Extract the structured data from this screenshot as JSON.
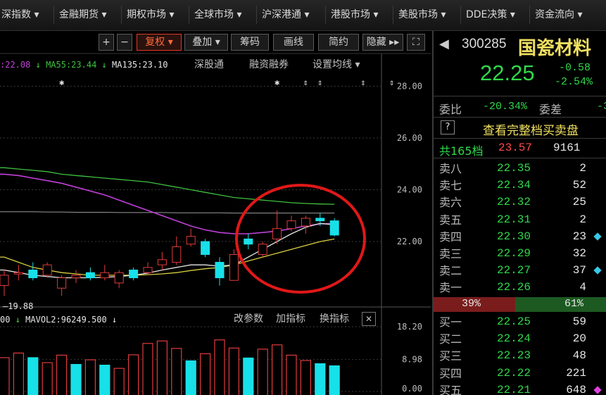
{
  "menu": [
    {
      "label": "深指数",
      "arrow": "▾"
    },
    {
      "label": "金融期货",
      "arrow": "▾"
    },
    {
      "label": "期权市场",
      "arrow": "▾"
    },
    {
      "label": "全球市场",
      "arrow": "▾"
    },
    {
      "label": "沪深港通",
      "arrow": "▾"
    },
    {
      "label": "港股市场",
      "arrow": "▾"
    },
    {
      "label": "美股市场",
      "arrow": "▾"
    },
    {
      "label": "DDE决策",
      "arrow": "▾"
    },
    {
      "label": "资金流向",
      "arrow": "▾"
    }
  ],
  "toolbar": {
    "plus": "+",
    "minus": "−",
    "fuquan": "复权 ▾",
    "diejia": "叠加 ▾",
    "chouma": "筹码",
    "huaxian": "画线",
    "jianyue": "简约",
    "yincang": "隐藏 ▸▸",
    "fullscreen": "⛶"
  },
  "ma": {
    "ma_partial": ":22.08",
    "ma_partial_arrow": "↓",
    "ma55": "MA55:23.44",
    "ma55_arrow": "↓",
    "ma135": "MA135:23.10",
    "option1": "深股通",
    "option2": "融资融券",
    "option3": "设置均线 ▾"
  },
  "price_axis": [
    "28.00",
    "26.00",
    "24.00",
    "22.00"
  ],
  "low_label": "19.88",
  "volume": {
    "line1": "00",
    "arrow1": "↓",
    "mavol2": "MAVOL2:96249.500",
    "arrow2": "↓",
    "opt1": "改参数",
    "opt2": "加指标",
    "opt3": "换指标",
    "close": "✕",
    "axis": [
      "18.20",
      "8.98",
      "0.00"
    ]
  },
  "quote": {
    "code": "300285",
    "name": "国瓷材料",
    "price": "22.25",
    "change": "-0.58",
    "change_pct": "-2.54%",
    "weibi_label": "委比",
    "weibi_value": "-20.34%",
    "weicha_label": "委差",
    "weicha_value": "-3",
    "help": "?",
    "full_book_link": "查看完整档买卖盘",
    "levels_label": "共165档",
    "levels_price": "23.57",
    "levels_vol": "9161",
    "sell": [
      {
        "label": "卖八",
        "price": "22.35",
        "vol": "2",
        "mark": ""
      },
      {
        "label": "卖七",
        "price": "22.34",
        "vol": "52",
        "mark": ""
      },
      {
        "label": "卖六",
        "price": "22.32",
        "vol": "25",
        "mark": ""
      },
      {
        "label": "卖五",
        "price": "22.31",
        "vol": "2",
        "mark": ""
      },
      {
        "label": "卖四",
        "price": "22.30",
        "vol": "23",
        "mark": "#38c8e8"
      },
      {
        "label": "卖三",
        "price": "22.29",
        "vol": "32",
        "mark": ""
      },
      {
        "label": "卖二",
        "price": "22.27",
        "vol": "37",
        "mark": "#38c8e8"
      },
      {
        "label": "卖一",
        "price": "22.26",
        "vol": "4",
        "mark": ""
      }
    ],
    "ratio_sell": "39%",
    "ratio_buy": "61%",
    "buy": [
      {
        "label": "买一",
        "price": "22.25",
        "vol": "59",
        "mark": ""
      },
      {
        "label": "买二",
        "price": "22.24",
        "vol": "20",
        "mark": ""
      },
      {
        "label": "买三",
        "price": "22.23",
        "vol": "48",
        "mark": ""
      },
      {
        "label": "买四",
        "price": "22.22",
        "vol": "221",
        "mark": ""
      },
      {
        "label": "买五",
        "price": "22.21",
        "vol": "648",
        "mark": "#e040e0"
      }
    ]
  },
  "colors": {
    "up": "#e03b3b",
    "down": "#18e0e8",
    "ma_white": "#e6e6e6",
    "ma_yellow": "#d8d040",
    "ma_magenta": "#c040d8",
    "ma_green": "#40c040",
    "circle": "#e01818",
    "price_green": "#30d84a"
  },
  "chart_data": [
    {
      "type": "candlestick",
      "ylim": [
        19.5,
        28.5
      ],
      "y_ticks": [
        28.0,
        26.0,
        24.0,
        22.0
      ],
      "low_annotation": 19.88,
      "candles": [
        {
          "o": 20.3,
          "c": 20.7,
          "h": 20.9,
          "l": 19.9
        },
        {
          "o": 20.8,
          "c": 20.8,
          "h": 21.1,
          "l": 20.5
        },
        {
          "o": 20.9,
          "c": 20.6,
          "h": 21.2,
          "l": 20.5
        },
        {
          "o": 20.7,
          "c": 21.1,
          "h": 21.2,
          "l": 20.6
        },
        {
          "o": 20.2,
          "c": 20.6,
          "h": 20.7,
          "l": 19.9
        },
        {
          "o": 20.6,
          "c": 20.7,
          "h": 20.9,
          "l": 20.4
        },
        {
          "o": 20.8,
          "c": 20.6,
          "h": 21.0,
          "l": 20.5
        },
        {
          "o": 20.6,
          "c": 20.8,
          "h": 21.1,
          "l": 20.5
        },
        {
          "o": 20.4,
          "c": 20.8,
          "h": 20.9,
          "l": 20.2
        },
        {
          "o": 20.9,
          "c": 20.6,
          "h": 21.0,
          "l": 20.5
        },
        {
          "o": 20.8,
          "c": 21.0,
          "h": 21.2,
          "l": 20.7
        },
        {
          "o": 21.1,
          "c": 21.3,
          "h": 21.6,
          "l": 20.9
        },
        {
          "o": 21.2,
          "c": 21.8,
          "h": 22.2,
          "l": 21.1
        },
        {
          "o": 21.9,
          "c": 22.2,
          "h": 22.5,
          "l": 21.8
        },
        {
          "o": 22.0,
          "c": 21.5,
          "h": 22.1,
          "l": 21.4
        },
        {
          "o": 21.2,
          "c": 20.6,
          "h": 21.4,
          "l": 20.3
        },
        {
          "o": 20.5,
          "c": 21.5,
          "h": 21.7,
          "l": 20.5
        },
        {
          "o": 22.1,
          "c": 21.9,
          "h": 22.3,
          "l": 21.7
        },
        {
          "o": 21.5,
          "c": 21.9,
          "h": 22.0,
          "l": 21.4
        },
        {
          "o": 22.1,
          "c": 22.5,
          "h": 23.2,
          "l": 21.9
        },
        {
          "o": 22.5,
          "c": 22.8,
          "h": 23.0,
          "l": 22.4
        },
        {
          "o": 22.6,
          "c": 22.9,
          "h": 23.0,
          "l": 22.3
        },
        {
          "o": 22.9,
          "c": 22.8,
          "h": 23.1,
          "l": 22.6
        },
        {
          "o": 22.8,
          "c": 22.25,
          "h": 22.9,
          "l": 22.2
        }
      ],
      "ma_white": [
        20.9,
        20.8,
        20.7,
        20.65,
        20.6,
        20.6,
        20.6,
        20.62,
        20.65,
        20.7,
        20.78,
        20.9,
        21.0,
        21.1,
        21.1,
        21.05,
        21.1,
        21.4,
        21.7,
        22.0,
        22.3,
        22.55,
        22.7,
        22.65
      ],
      "ma_yellow": [
        21.4,
        21.2,
        21.0,
        20.9,
        20.8,
        20.75,
        20.7,
        20.7,
        20.7,
        20.7,
        20.72,
        20.75,
        20.8,
        20.88,
        20.95,
        21.0,
        21.1,
        21.25,
        21.4,
        21.55,
        21.7,
        21.85,
        22.0,
        22.1
      ],
      "ma_magenta": [
        24.6,
        24.55,
        24.45,
        24.35,
        24.25,
        24.1,
        23.95,
        23.8,
        23.6,
        23.4,
        23.2,
        23.0,
        22.8,
        22.6,
        22.45,
        22.35,
        22.3,
        22.3,
        22.35,
        22.4,
        22.5,
        22.6,
        22.68,
        22.7
      ],
      "ma_green": [
        24.85,
        24.8,
        24.75,
        24.7,
        24.6,
        24.55,
        24.5,
        24.45,
        24.4,
        24.35,
        24.3,
        24.2,
        24.1,
        24.0,
        23.9,
        23.8,
        23.7,
        23.65,
        23.6,
        23.55,
        23.5,
        23.47,
        23.45,
        23.44
      ],
      "ma_grey": [
        23.15,
        23.15,
        23.15,
        23.14,
        23.14,
        23.13,
        23.13,
        23.13,
        23.12,
        23.12,
        23.12,
        23.12,
        23.11,
        23.11,
        23.11,
        23.11,
        23.1,
        23.1,
        23.1,
        23.1,
        23.1,
        23.1,
        23.1,
        23.1
      ],
      "markers": [
        4,
        19,
        21,
        22,
        25,
        27
      ]
    },
    {
      "type": "bar",
      "ylim": [
        0,
        18.2
      ],
      "y_ticks": [
        18.2,
        8.98,
        0.0
      ],
      "values": [
        9.5,
        10.8,
        9.5,
        8.1,
        10.2,
        7.6,
        8.9,
        7.4,
        6.5,
        10.3,
        13.5,
        14.2,
        12.1,
        8.6,
        10.6,
        14.5,
        12.2,
        9.4,
        11.9,
        13.1,
        10.2,
        8.7,
        7.8,
        7.2
      ],
      "up": [
        true,
        true,
        false,
        true,
        true,
        false,
        true,
        false,
        true,
        true,
        true,
        true,
        true,
        false,
        true,
        true,
        true,
        false,
        true,
        true,
        true,
        true,
        false,
        false
      ]
    }
  ]
}
